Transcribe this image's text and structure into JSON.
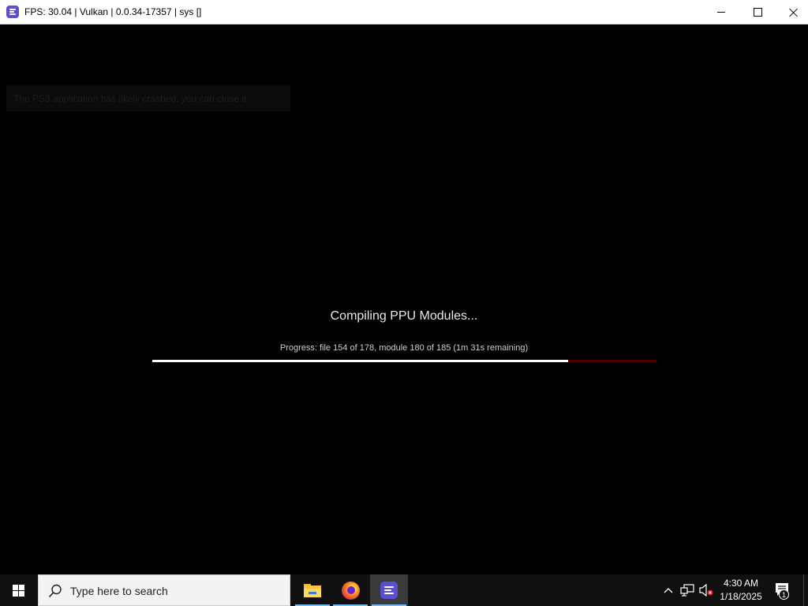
{
  "window": {
    "title": "FPS: 30.04 | Vulkan | 0.0.34-17357 | sys []",
    "icon": "rpcs3-icon"
  },
  "game": {
    "faded_notice": "The PS3 application has likely crashed, you can close it.",
    "compile_title": "Compiling PPU Modules...",
    "progress_text": "Progress: file 154 of 178, module 180 of 185 (1m 31s remaining)",
    "progress_fraction": 0.825,
    "progress_color": "#ffffff",
    "progress_track_color": "#4a0000"
  },
  "taskbar": {
    "search_placeholder": "Type here to search",
    "pinned": [
      "file-explorer-icon",
      "firefox-icon",
      "rpcs3-icon"
    ],
    "time": "4:30 AM",
    "date": "1/18/2025",
    "notification_count": "1"
  }
}
